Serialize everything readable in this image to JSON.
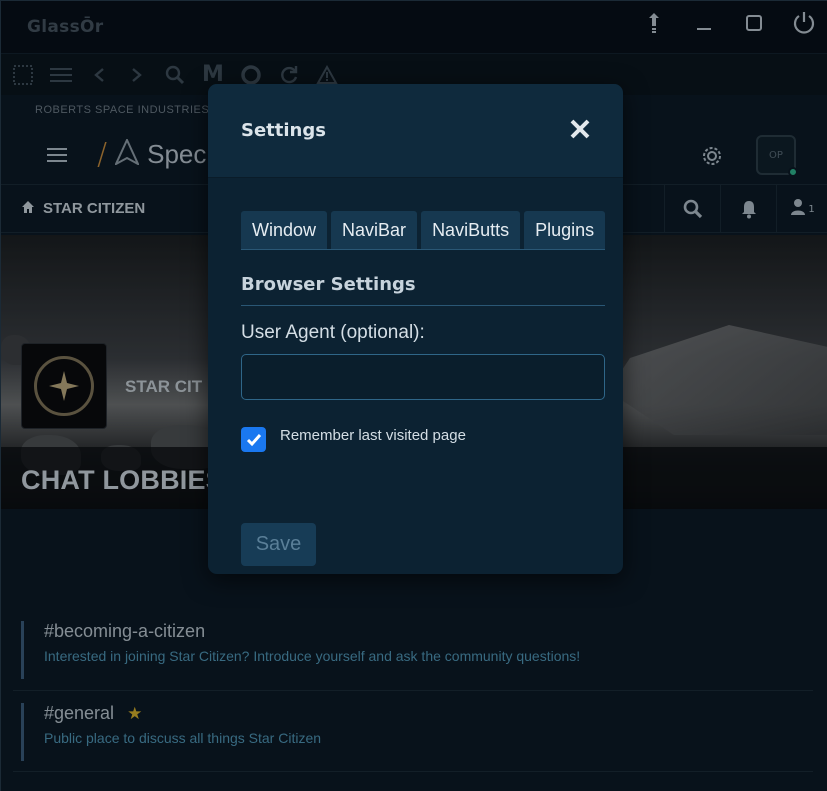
{
  "window": {
    "brand": "GlassŌr",
    "controls": {
      "pin_icon": "pin-icon",
      "minimize_icon": "minimize-icon",
      "maximize_icon": "maximize-icon",
      "power_icon": "power-icon"
    }
  },
  "navibar": {
    "buttons": [
      "sidebar-icon",
      "menu-icon",
      "back-icon",
      "forward-icon",
      "search-icon",
      "m-icon",
      "circle-icon",
      "reload-icon",
      "warning-icon"
    ],
    "m_label": "M"
  },
  "site": {
    "top_label": "ROBERTS SPACE INDUSTRIES®",
    "spec_text": "Spec",
    "avatar_initials": "OP",
    "section_label": "STAR CITIZEN",
    "user_count": "1",
    "card_name": "STAR CIT",
    "lobbies_title": "CHAT LOBBIES",
    "lobbies": [
      {
        "name": "#becoming-a-citizen",
        "description": "Interested in joining Star Citizen? Introduce yourself and ask the community questions!",
        "starred": false
      },
      {
        "name": "#general",
        "description": "Public place to discuss all things Star Citizen",
        "starred": true
      }
    ]
  },
  "modal": {
    "title": "Settings",
    "tabs": [
      "Window",
      "NaviBar",
      "NaviButts",
      "Plugins"
    ],
    "section_title": "Browser Settings",
    "user_agent_label": "User Agent (optional):",
    "user_agent_value": "",
    "user_agent_placeholder": "",
    "remember_label": "Remember last visited page",
    "remember_checked": true,
    "save_label": "Save"
  },
  "colors": {
    "accent_blue": "#1a78f0",
    "modal_bg": "#0c2232",
    "lobby_desc": "#4e93b3",
    "star": "#d2ad2b"
  }
}
